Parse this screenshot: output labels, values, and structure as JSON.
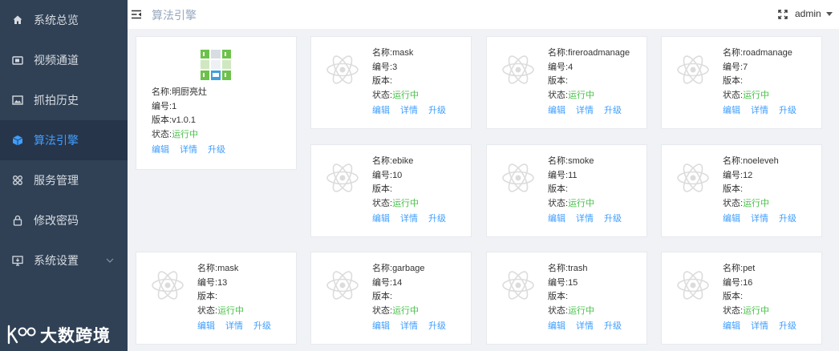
{
  "sidebar": {
    "items": [
      {
        "label": "系统总览",
        "icon": "home-icon"
      },
      {
        "label": "视频通道",
        "icon": "video-icon"
      },
      {
        "label": "抓拍历史",
        "icon": "image-icon"
      },
      {
        "label": "算法引擎",
        "icon": "cube-icon",
        "active": true
      },
      {
        "label": "服务管理",
        "icon": "grid-icon"
      },
      {
        "label": "修改密码",
        "icon": "lock-icon"
      },
      {
        "label": "系统设置",
        "icon": "monitor-icon"
      }
    ],
    "logo_text": "大数跨境"
  },
  "header": {
    "breadcrumb": "算法引擎",
    "user": "admin"
  },
  "labels": {
    "name": "名称:",
    "number": "编号:",
    "version": "版本:",
    "status": "状态:",
    "edit": "编辑",
    "detail": "详情",
    "upgrade": "升级"
  },
  "colors": {
    "sidebar_bg": "#304156",
    "active": "#409eff",
    "status_running": "#48c04a"
  },
  "algorithms": [
    {
      "name": "明厨亮灶",
      "number": "1",
      "version": "v1.0.1",
      "status": "运行中"
    },
    {
      "name": "mask",
      "number": "3",
      "version": "",
      "status": "运行中"
    },
    {
      "name": "fireroadmanage",
      "number": "4",
      "version": "",
      "status": "运行中"
    },
    {
      "name": "roadmanage",
      "number": "7",
      "version": "",
      "status": "运行中"
    },
    {
      "name": "ebike",
      "number": "10",
      "version": "",
      "status": "运行中"
    },
    {
      "name": "smoke",
      "number": "11",
      "version": "",
      "status": "运行中"
    },
    {
      "name": "noeleveh",
      "number": "12",
      "version": "",
      "status": "运行中"
    },
    {
      "name": "mask",
      "number": "13",
      "version": "",
      "status": "运行中"
    },
    {
      "name": "garbage",
      "number": "14",
      "version": "",
      "status": "运行中"
    },
    {
      "name": "trash",
      "number": "15",
      "version": "",
      "status": "运行中"
    },
    {
      "name": "pet",
      "number": "16",
      "version": "",
      "status": "运行中"
    }
  ]
}
